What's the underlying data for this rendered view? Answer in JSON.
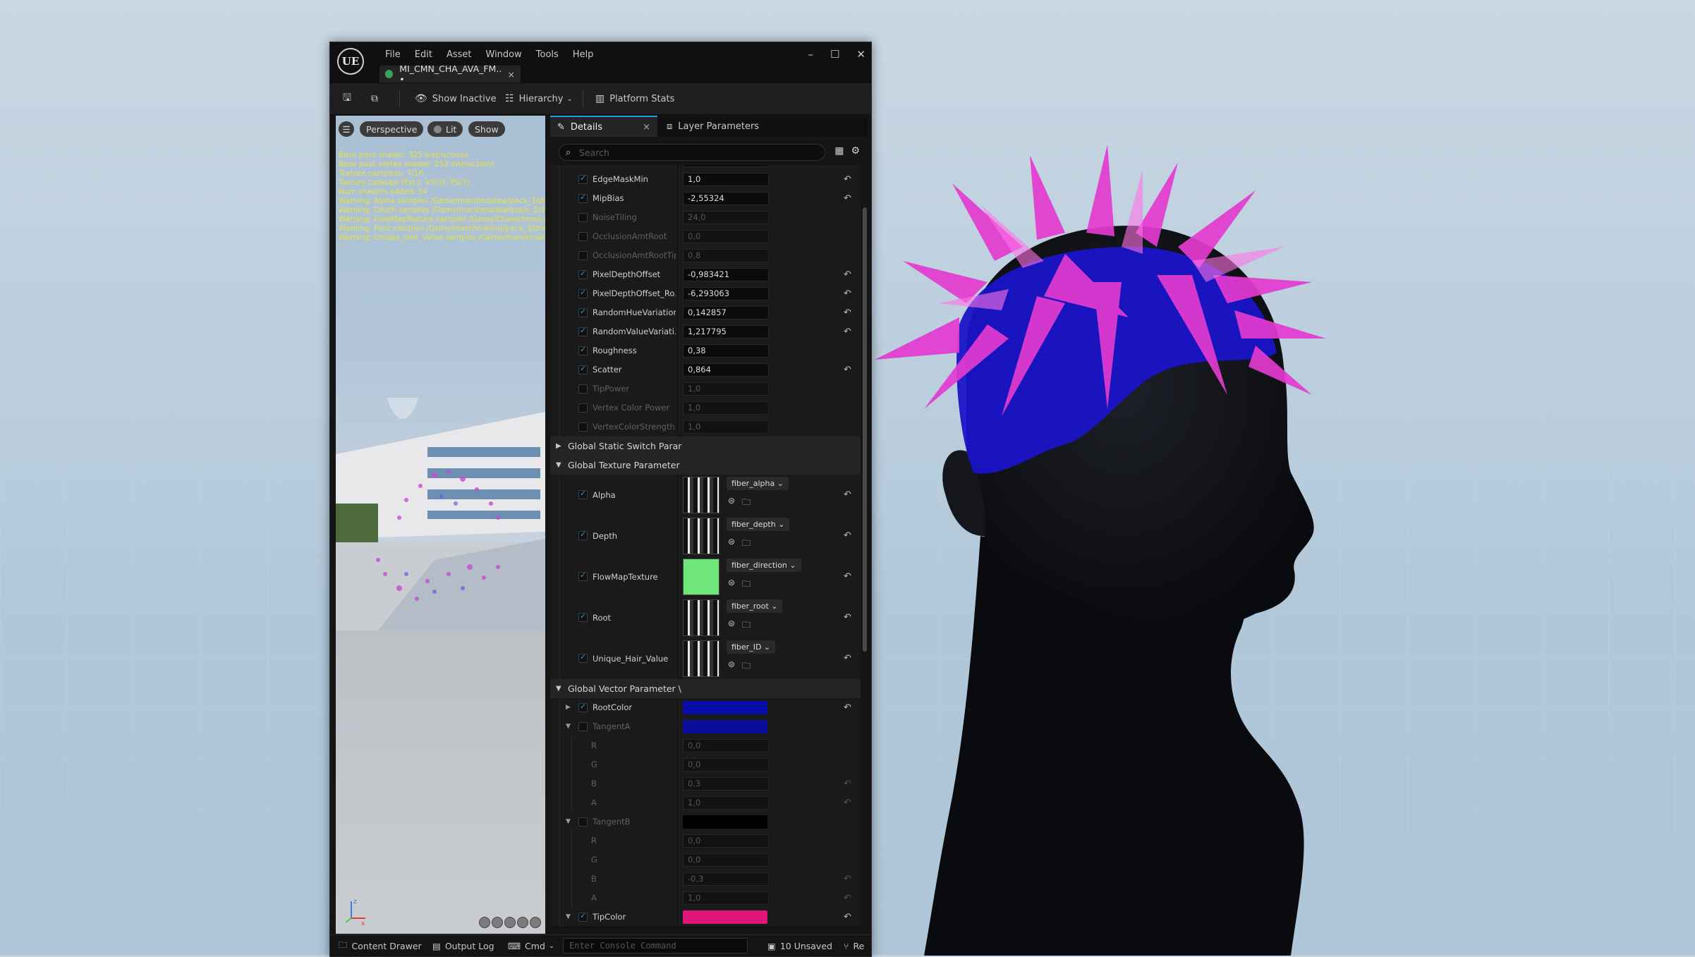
{
  "window": {
    "logo": "UE",
    "menu": [
      "File",
      "Edit",
      "Asset",
      "Window",
      "Tools",
      "Help"
    ],
    "tab_title": "MI_CMN_CHA_AVA_FM.. •",
    "tab_close": "×",
    "controls": [
      "–",
      "☐",
      "✕"
    ]
  },
  "toolbar": {
    "show_inactive": "Show Inactive",
    "hierarchy": "Hierarchy",
    "platform_stats": "Platform Stats"
  },
  "viewport": {
    "perspective": "Perspective",
    "lit": "Lit",
    "show": "Show",
    "stats": [
      "Base pass shader: 325 instructions",
      "Base pass vertex shader: 252 instructions",
      "Texture samplers: 7/16",
      "Texture Lookups (Est.): VS(3), PS(7)",
      "Num shaders added: 34",
      "Warning: Alpha samples /Game/marshmallow/pack_3/dreadlock",
      "Warning: Depth samples /Game/marshmallow/pack_3/dreadlock",
      "Warning: FlowMapTexture samples /Game/Characters/LaCh",
      "Warning: Root samples /Game/marshmallow/pack_3/dreadlock",
      "Warning: Unique_Hair_Value samples /Game/marshmallow/pack_3/dreadlock"
    ],
    "axis_z": "z",
    "axis_x": "x"
  },
  "details": {
    "tab_details": "Details",
    "tab_close": "×",
    "tab_layers": "Layer Parameters",
    "search_placeholder": "Search",
    "reset_glyph": "↶",
    "scalar_rows": [
      {
        "label": "EdgeMaskMin",
        "value": "1,0",
        "on": true,
        "reset": true
      },
      {
        "label": "MipBias",
        "value": "-2,55324",
        "on": true,
        "reset": true
      },
      {
        "label": "NoiseTiling",
        "value": "24,0",
        "on": false,
        "reset": false
      },
      {
        "label": "OcclusionAmtRoot",
        "value": "0,0",
        "on": false,
        "reset": false
      },
      {
        "label": "OcclusionAmtRootTip",
        "value": "0,8",
        "on": false,
        "reset": false
      },
      {
        "label": "PixelDepthOffset",
        "value": "-0,983421",
        "on": true,
        "reset": true
      },
      {
        "label": "PixelDepthOffset_Ro...",
        "value": "-6,293063",
        "on": true,
        "reset": true
      },
      {
        "label": "RandomHueVariation",
        "value": "0,142857",
        "on": true,
        "reset": true
      },
      {
        "label": "RandomValueVariati...",
        "value": "1,217795",
        "on": true,
        "reset": true
      },
      {
        "label": "Roughness",
        "value": "0,38",
        "on": true,
        "reset": false
      },
      {
        "label": "Scatter",
        "value": "0,864",
        "on": true,
        "reset": true
      },
      {
        "label": "TipPower",
        "value": "1,0",
        "on": false,
        "reset": false
      },
      {
        "label": "Vertex Color Power",
        "value": "1,0",
        "on": false,
        "reset": false
      },
      {
        "label": "VertexColorStrength",
        "value": "1,0",
        "on": false,
        "reset": false
      }
    ],
    "group_static_switch": "Global Static Switch Parar",
    "group_texture": "Global Texture Parameter",
    "texture_rows": [
      {
        "label": "Alpha",
        "asset": "fiber_alpha ⌄"
      },
      {
        "label": "Depth",
        "asset": "fiber_depth ⌄"
      },
      {
        "label": "FlowMapTexture",
        "asset": "fiber_direction ⌄"
      },
      {
        "label": "Root",
        "asset": "fiber_root ⌄"
      },
      {
        "label": "Unique_Hair_Value",
        "asset": "fiber_ID ⌄"
      }
    ],
    "group_vector": "Global Vector Parameter \\",
    "vector_rows": [
      {
        "label": "RootColor",
        "color": "#0a0ca6",
        "on": true
      },
      {
        "label": "TangentA",
        "color": "#0b0d9c",
        "on": false
      },
      {
        "label": "TangentB",
        "color": "#000000",
        "on": false
      },
      {
        "label": "TipColor",
        "color": "#e0157a",
        "on": true
      }
    ],
    "tangent_a": [
      {
        "label": "R",
        "value": "0,0",
        "reset": false
      },
      {
        "label": "G",
        "value": "0,0",
        "reset": false
      },
      {
        "label": "B",
        "value": "0,3",
        "reset": true
      },
      {
        "label": "A",
        "value": "1,0",
        "reset": true
      }
    ],
    "tangent_b": [
      {
        "label": "R",
        "value": "0,0",
        "reset": false
      },
      {
        "label": "G",
        "value": "0,0",
        "reset": false
      },
      {
        "label": "B",
        "value": "-0,3",
        "reset": true
      },
      {
        "label": "A",
        "value": "1,0",
        "reset": true
      }
    ]
  },
  "statusbar": {
    "content_drawer": "Content Drawer",
    "output_log": "Output Log",
    "cmd": "Cmd",
    "console_placeholder": "Enter Console Command",
    "unsaved": "10 Unsaved",
    "revision": "Re"
  },
  "colors": {
    "accent": "#1f9bde",
    "hair_root": "#1a14c8",
    "hair_tip": "#e43bd0",
    "stats_text": "#e6e04a"
  }
}
